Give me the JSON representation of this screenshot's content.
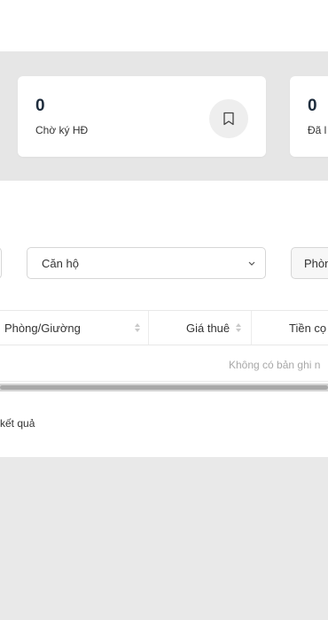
{
  "stats": [
    {
      "value": "0",
      "label": "Chờ ký HĐ",
      "icon": "bookmark-icon"
    },
    {
      "value": "0",
      "label": "Đã l"
    }
  ],
  "filters": {
    "property_type": {
      "value": "Căn hộ"
    },
    "room": {
      "value": "Phòn"
    }
  },
  "table": {
    "columns": [
      "Phòng/Giường",
      "Giá thuê",
      "Tiền cọ"
    ],
    "empty_message": "Không có bản ghi n"
  },
  "footer": {
    "result_text": "kết quả"
  }
}
